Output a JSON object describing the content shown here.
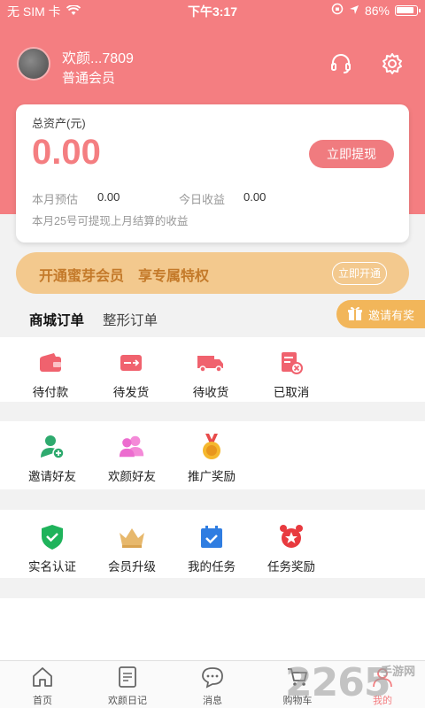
{
  "status_bar": {
    "carrier": "无 SIM 卡",
    "time": "下午3:17",
    "battery": "86%"
  },
  "profile": {
    "username": "欢颜...7809",
    "level": "普通会员"
  },
  "header_icons": {
    "service": "headset-icon",
    "settings": "gear-icon"
  },
  "asset": {
    "title": "总资产(元)",
    "amount": "0.00",
    "withdraw_label": "立即提现",
    "month_estimate_label": "本月预估",
    "month_estimate_value": "0.00",
    "today_income_label": "今日收益",
    "today_income_value": "0.00",
    "note": "本月25号可提现上月结算的收益"
  },
  "vip": {
    "text": "开通蜜芽会员　享专属特权",
    "button": "立即开通"
  },
  "tabs": [
    {
      "label": "商城订单"
    },
    {
      "label": "整形订单"
    }
  ],
  "invite_float": {
    "label": "邀请有奖",
    "icon": "gift-icon"
  },
  "orders": [
    {
      "label": "待付款",
      "icon": "wallet-icon"
    },
    {
      "label": "待发货",
      "icon": "card-icon"
    },
    {
      "label": "待收货",
      "icon": "truck-icon"
    },
    {
      "label": "已取消",
      "icon": "cancel-doc-icon"
    }
  ],
  "social": [
    {
      "label": "邀请好友",
      "icon": "add-user-icon"
    },
    {
      "label": "欢颜好友",
      "icon": "friends-icon"
    },
    {
      "label": "推广奖励",
      "icon": "medal-icon"
    }
  ],
  "tasks": [
    {
      "label": "实名认证",
      "icon": "shield-check-icon"
    },
    {
      "label": "会员升级",
      "icon": "crown-icon"
    },
    {
      "label": "我的任务",
      "icon": "calendar-check-icon"
    },
    {
      "label": "任务奖励",
      "icon": "alarm-icon"
    }
  ],
  "bottom_nav": [
    {
      "label": "首页",
      "icon": "home-icon"
    },
    {
      "label": "欢颜日记",
      "icon": "diary-icon"
    },
    {
      "label": "消息",
      "icon": "chat-icon"
    },
    {
      "label": "购物车",
      "icon": "cart-icon"
    },
    {
      "label": "我的",
      "icon": "user-icon"
    }
  ],
  "watermark": {
    "number": "2265",
    "text": "手游网"
  },
  "colors": {
    "brand": "#f47e81",
    "vip": "#f3c98e",
    "vip_text": "#c47a2a",
    "invite": "#f2b65a"
  }
}
